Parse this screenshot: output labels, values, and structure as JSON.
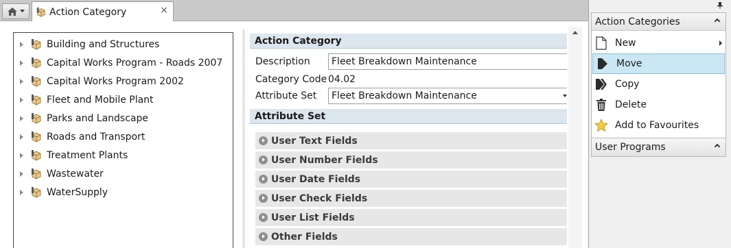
{
  "tab": {
    "title": "Action Category",
    "close_glyph": "×"
  },
  "tree": {
    "items": [
      {
        "label": "Building and Structures"
      },
      {
        "label": "Capital Works Program - Roads 2007"
      },
      {
        "label": "Capital Works Program 2002"
      },
      {
        "label": "Fleet and Mobile Plant"
      },
      {
        "label": "Parks and Landscape"
      },
      {
        "label": "Roads and Transport"
      },
      {
        "label": "Treatment Plants"
      },
      {
        "label": "Wastewater"
      },
      {
        "label": "WaterSupply"
      }
    ]
  },
  "details": {
    "section_title": "Action Category",
    "description_label": "Description",
    "description_value": "Fleet Breakdown Maintenance",
    "category_code_label": "Category Code",
    "category_code_value": "04.02",
    "attribute_set_label": "Attribute Set",
    "attribute_set_value": "Fleet Breakdown Maintenance"
  },
  "attribute_set": {
    "section_title": "Attribute Set",
    "groups": [
      {
        "label": "User Text Fields"
      },
      {
        "label": "User Number Fields"
      },
      {
        "label": "User Date Fields"
      },
      {
        "label": "User Check Fields"
      },
      {
        "label": "User List Fields"
      },
      {
        "label": "Other Fields"
      }
    ]
  },
  "side_pane": {
    "action_categories": {
      "title": "Action Categories",
      "items": [
        {
          "label": "New",
          "icon": "new-document-icon"
        },
        {
          "label": "Move",
          "icon": "move-arrow-icon"
        },
        {
          "label": "Copy",
          "icon": "copy-arrows-icon"
        },
        {
          "label": "Delete",
          "icon": "trash-icon"
        },
        {
          "label": "Add to Favourites",
          "icon": "star-icon"
        }
      ]
    },
    "user_programs": {
      "title": "User Programs"
    }
  },
  "colors": {
    "section_header_bg": "#dce6ef",
    "active_item_bg": "#cbe7f3",
    "tab_bar_bg": "#c9c9c9"
  }
}
